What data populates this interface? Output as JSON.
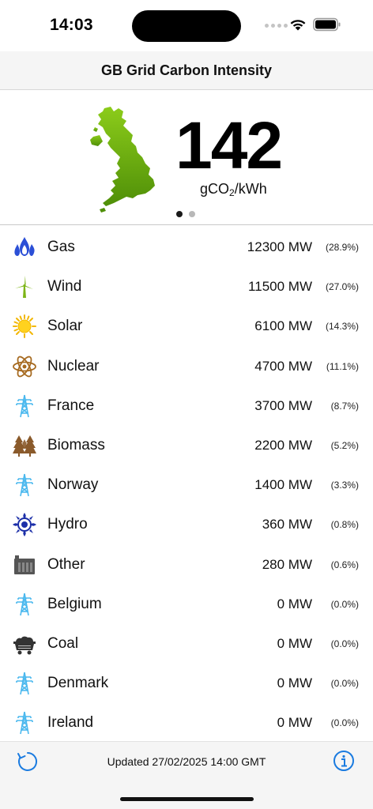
{
  "status_bar": {
    "time": "14:03"
  },
  "nav": {
    "title": "GB Grid Carbon Intensity"
  },
  "hero": {
    "intensity": "142",
    "unit_prefix": "gCO",
    "unit_sub": "2",
    "unit_suffix": "/kWh",
    "page_count": 2,
    "active_page": 1
  },
  "colors": {
    "map_green": "#6aa80e",
    "icon_blue": "#4ab8ee",
    "gas_blue": "#2b4fd6",
    "hydro_navy": "#1c2fa8",
    "accent_blue": "#1a7be0"
  },
  "fuels": [
    {
      "name": "Gas",
      "mw": "12300 MW",
      "pct": "(28.9%)",
      "icon": "gas-flame-icon"
    },
    {
      "name": "Wind",
      "mw": "11500 MW",
      "pct": "(27.0%)",
      "icon": "wind-turbine-icon"
    },
    {
      "name": "Solar",
      "mw": "6100 MW",
      "pct": "(14.3%)",
      "icon": "sun-icon"
    },
    {
      "name": "Nuclear",
      "mw": "4700 MW",
      "pct": "(11.1%)",
      "icon": "atom-icon"
    },
    {
      "name": "France",
      "mw": "3700 MW",
      "pct": "(8.7%)",
      "icon": "pylon-icon"
    },
    {
      "name": "Biomass",
      "mw": "2200 MW",
      "pct": "(5.2%)",
      "icon": "trees-icon"
    },
    {
      "name": "Norway",
      "mw": "1400 MW",
      "pct": "(3.3%)",
      "icon": "pylon-icon"
    },
    {
      "name": "Hydro",
      "mw": "360 MW",
      "pct": "(0.8%)",
      "icon": "hydro-icon"
    },
    {
      "name": "Other",
      "mw": "280 MW",
      "pct": "(0.6%)",
      "icon": "factory-icon"
    },
    {
      "name": "Belgium",
      "mw": "0 MW",
      "pct": "(0.0%)",
      "icon": "pylon-icon"
    },
    {
      "name": "Coal",
      "mw": "0 MW",
      "pct": "(0.0%)",
      "icon": "coal-cart-icon"
    },
    {
      "name": "Denmark",
      "mw": "0 MW",
      "pct": "(0.0%)",
      "icon": "pylon-icon"
    },
    {
      "name": "Ireland",
      "mw": "0 MW",
      "pct": "(0.0%)",
      "icon": "pylon-icon"
    }
  ],
  "toolbar": {
    "updated": "Updated 27/02/2025 14:00 GMT"
  }
}
